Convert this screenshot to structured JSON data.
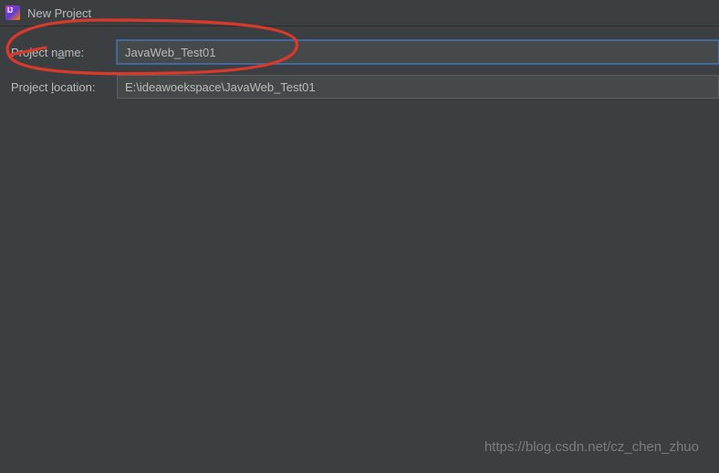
{
  "window": {
    "title": "New Project"
  },
  "form": {
    "project_name_label_pre": "Project n",
    "project_name_label_mn": "a",
    "project_name_label_post": "me:",
    "project_name_value": "JavaWeb_Test01",
    "project_location_label_pre": "Project ",
    "project_location_label_mn": "l",
    "project_location_label_post": "ocation:",
    "project_location_value": "E:\\ideawoekspace\\JavaWeb_Test01"
  },
  "watermark": "https://blog.csdn.net/cz_chen_zhuo"
}
